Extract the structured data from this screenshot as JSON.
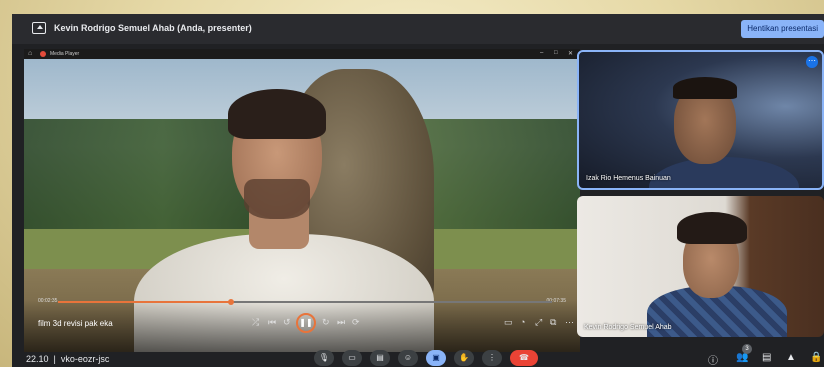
{
  "header": {
    "presenter_title": "Kevin Rodrigo Semuel Ahab (Anda, presenter)",
    "stop_label": "Hentikan presentasi"
  },
  "media_player": {
    "app_title": "Media Player",
    "film_title": "film 3d revisi pak eka",
    "time_elapsed": "00:02:35",
    "time_total": "00:07:35",
    "progress": 0.35
  },
  "participants": [
    {
      "name": "Izak Rio Hemenus Bainuan"
    },
    {
      "name": "Kevin Rodrigo Semuel Ahab"
    }
  ],
  "footer": {
    "clock": "22.10",
    "meeting_code": "vko-eozr-jsc",
    "participant_count": "3"
  },
  "colors": {
    "accent": "#8ab4f8",
    "hangup": "#ea4335",
    "progress": "#e8743b"
  }
}
